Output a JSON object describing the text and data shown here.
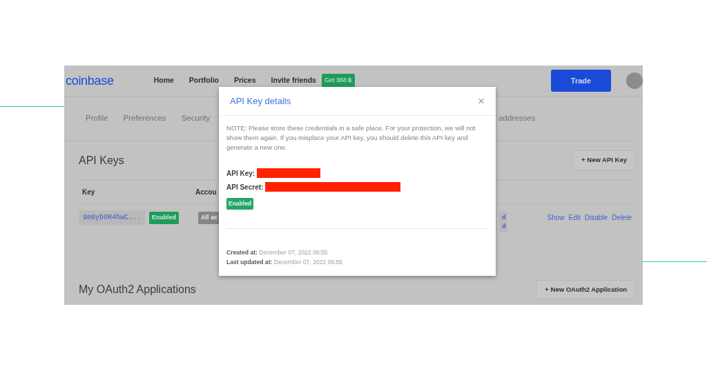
{
  "navbar": {
    "logo": "coinbase",
    "links": [
      "Home",
      "Portfolio",
      "Prices",
      "Invite friends"
    ],
    "invite_badge": "Get 368 ฿",
    "trade_button": "Trade"
  },
  "subnav": {
    "tabs": [
      "Profile",
      "Preferences",
      "Security",
      "addresses"
    ]
  },
  "api_keys": {
    "title": "API Keys",
    "new_button": "+ New API Key",
    "columns": [
      "Key",
      "Accou"
    ],
    "rows": [
      {
        "key": "9m0yb0R4hwC...",
        "status": "Enabled",
        "account": "All ac",
        "column_3": [
          "d",
          "d"
        ],
        "actions": [
          "Show",
          "Edit",
          "Disable",
          "Delete"
        ]
      }
    ]
  },
  "oauth": {
    "title": "My OAuth2 Applications",
    "new_button": "+ New OAuth2 Application"
  },
  "modal": {
    "title": "API Key details",
    "close": "×",
    "note": "NOTE: Please store these credentials in a safe place. For your protection, we will not show them again. If you misplace your API key, you should delete this API key and generate a new one.",
    "fields": [
      {
        "label": "API Key:",
        "redacted": true
      },
      {
        "label": "API Secret:",
        "redacted": true
      }
    ],
    "status": "Enabled",
    "dates": [
      {
        "label": "Created at:",
        "value": "December 07, 2022 06:55"
      },
      {
        "label": "Last updated at:",
        "value": "December 07, 2022 06:55"
      }
    ]
  }
}
